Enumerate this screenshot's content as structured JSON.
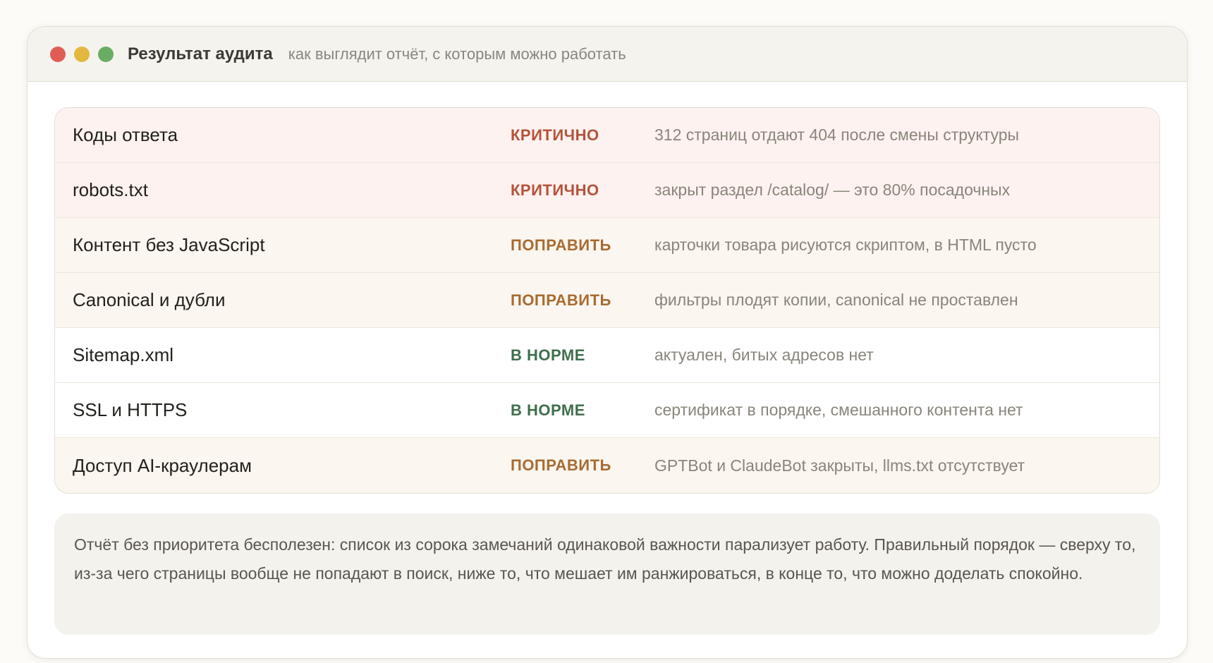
{
  "window": {
    "title": "Результат аудита",
    "subtitle": "как выглядит отчёт, с которым можно работать",
    "controls": [
      "close",
      "minimize",
      "maximize"
    ]
  },
  "colors": {
    "critical": "#b5523c",
    "fix": "#a86b32",
    "ok": "#3f6f4c",
    "critical_row_bg": "#fdf2ef",
    "fix_row_bg": "#fbf6ef"
  },
  "rows": [
    {
      "name": "Коды ответа",
      "status": "КРИТИЧНО",
      "level": "critical",
      "desc": "312 страниц отдают 404 после смены структуры"
    },
    {
      "name": "robots.txt",
      "status": "КРИТИЧНО",
      "level": "critical",
      "desc": "закрыт раздел /catalog/ — это 80% посадочных"
    },
    {
      "name": "Контент без JavaScript",
      "status": "ПОПРАВИТЬ",
      "level": "fix",
      "desc": "карточки товара рисуются скриптом, в HTML пусто"
    },
    {
      "name": "Canonical и дубли",
      "status": "ПОПРАВИТЬ",
      "level": "fix",
      "desc": "фильтры плодят копии, canonical не проставлен"
    },
    {
      "name": "Sitemap.xml",
      "status": "В НОРМЕ",
      "level": "ok",
      "desc": "актуален, битых адресов нет"
    },
    {
      "name": "SSL и HTTPS",
      "status": "В НОРМЕ",
      "level": "ok",
      "desc": "сертификат в порядке, смешанного контента нет"
    },
    {
      "name": "Доступ AI-краулерам",
      "status": "ПОПРАВИТЬ",
      "level": "fix",
      "desc": "GPTBot и ClaudeBot закрыты, llms.txt отсутствует"
    }
  ],
  "note": "Отчёт без приоритета бесполезен: список из сорока замечаний одинаковой важности парализует работу. Правильный порядок — сверху то, из-за чего страницы вообще не попадают в поиск, ниже то, что мешает им ранжироваться, в конце то, что можно доделать спокойно."
}
